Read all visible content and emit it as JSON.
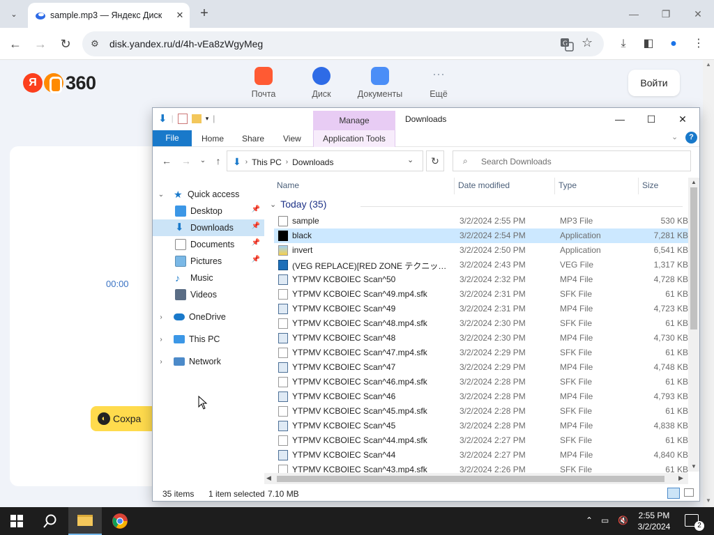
{
  "browser": {
    "tab_title": "sample.mp3 — Яндекс Диск",
    "url": "disk.yandex.ru/d/4h-vEa8zWgyMeg"
  },
  "yandex": {
    "logo_text": "360",
    "logo_ya": "Я",
    "services": [
      {
        "label": "Почта",
        "color": "#ff5a33"
      },
      {
        "label": "Диск",
        "color": "#2e6be6"
      },
      {
        "label": "Документы",
        "color": "#4b8ef7"
      },
      {
        "label": "Ещё",
        "color": "#9aa4b2"
      }
    ],
    "login": "Войти",
    "time": "00:00",
    "save": "Сохра"
  },
  "explorer": {
    "title": "Downloads",
    "manage": "Manage",
    "ribbon": {
      "file": "File",
      "home": "Home",
      "share": "Share",
      "view": "View",
      "app_tools": "Application Tools"
    },
    "path": [
      "This PC",
      "Downloads"
    ],
    "search_placeholder": "Search Downloads",
    "nav": {
      "quick_access": "Quick access",
      "items": [
        "Desktop",
        "Downloads",
        "Documents",
        "Pictures",
        "Music",
        "Videos"
      ],
      "onedrive": "OneDrive",
      "this_pc": "This PC",
      "network": "Network"
    },
    "columns": {
      "name": "Name",
      "date": "Date modified",
      "type": "Type",
      "size": "Size"
    },
    "group": "Today (35)",
    "files": [
      {
        "name": "sample",
        "date": "3/2/2024 2:55 PM",
        "type": "MP3 File",
        "size": "530 KB",
        "icon": "mp3"
      },
      {
        "name": "black",
        "date": "3/2/2024 2:54 PM",
        "type": "Application",
        "size": "7,281 KB",
        "icon": "black"
      },
      {
        "name": "invert",
        "date": "3/2/2024 2:50 PM",
        "type": "Application",
        "size": "6,541 KB",
        "icon": "app"
      },
      {
        "name": "(VEG REPLACE)[RED ZONE テクニック][thek...",
        "date": "3/2/2024 2:43 PM",
        "type": "VEG File",
        "size": "1,317 KB",
        "icon": "veg"
      },
      {
        "name": "YTPMV KCBOIEC Scan^50",
        "date": "3/2/2024 2:32 PM",
        "type": "MP4 File",
        "size": "4,728 KB",
        "icon": "mp4"
      },
      {
        "name": "YTPMV KCBOIEC Scan^49.mp4.sfk",
        "date": "3/2/2024 2:31 PM",
        "type": "SFK File",
        "size": "61 KB",
        "icon": "sfk"
      },
      {
        "name": "YTPMV KCBOIEC Scan^49",
        "date": "3/2/2024 2:31 PM",
        "type": "MP4 File",
        "size": "4,723 KB",
        "icon": "mp4"
      },
      {
        "name": "YTPMV KCBOIEC Scan^48.mp4.sfk",
        "date": "3/2/2024 2:30 PM",
        "type": "SFK File",
        "size": "61 KB",
        "icon": "sfk"
      },
      {
        "name": "YTPMV KCBOIEC Scan^48",
        "date": "3/2/2024 2:30 PM",
        "type": "MP4 File",
        "size": "4,730 KB",
        "icon": "mp4"
      },
      {
        "name": "YTPMV KCBOIEC Scan^47.mp4.sfk",
        "date": "3/2/2024 2:29 PM",
        "type": "SFK File",
        "size": "61 KB",
        "icon": "sfk"
      },
      {
        "name": "YTPMV KCBOIEC Scan^47",
        "date": "3/2/2024 2:29 PM",
        "type": "MP4 File",
        "size": "4,748 KB",
        "icon": "mp4"
      },
      {
        "name": "YTPMV KCBOIEC Scan^46.mp4.sfk",
        "date": "3/2/2024 2:28 PM",
        "type": "SFK File",
        "size": "61 KB",
        "icon": "sfk"
      },
      {
        "name": "YTPMV KCBOIEC Scan^46",
        "date": "3/2/2024 2:28 PM",
        "type": "MP4 File",
        "size": "4,793 KB",
        "icon": "mp4"
      },
      {
        "name": "YTPMV KCBOIEC Scan^45.mp4.sfk",
        "date": "3/2/2024 2:28 PM",
        "type": "SFK File",
        "size": "61 KB",
        "icon": "sfk"
      },
      {
        "name": "YTPMV KCBOIEC Scan^45",
        "date": "3/2/2024 2:28 PM",
        "type": "MP4 File",
        "size": "4,838 KB",
        "icon": "mp4"
      },
      {
        "name": "YTPMV KCBOIEC Scan^44.mp4.sfk",
        "date": "3/2/2024 2:27 PM",
        "type": "SFK File",
        "size": "61 KB",
        "icon": "sfk"
      },
      {
        "name": "YTPMV KCBOIEC Scan^44",
        "date": "3/2/2024 2:27 PM",
        "type": "MP4 File",
        "size": "4,840 KB",
        "icon": "mp4"
      },
      {
        "name": "YTPMV KCBOIEC Scan^43.mp4.sfk",
        "date": "3/2/2024 2:26 PM",
        "type": "SFK File",
        "size": "61 KB",
        "icon": "sfk"
      }
    ],
    "selected_index": 1,
    "status": {
      "items": "35 items",
      "selected": "1 item selected",
      "size": "7.10 MB"
    }
  },
  "taskbar": {
    "time": "2:55 PM",
    "date": "3/2/2024",
    "notification_count": "2"
  }
}
